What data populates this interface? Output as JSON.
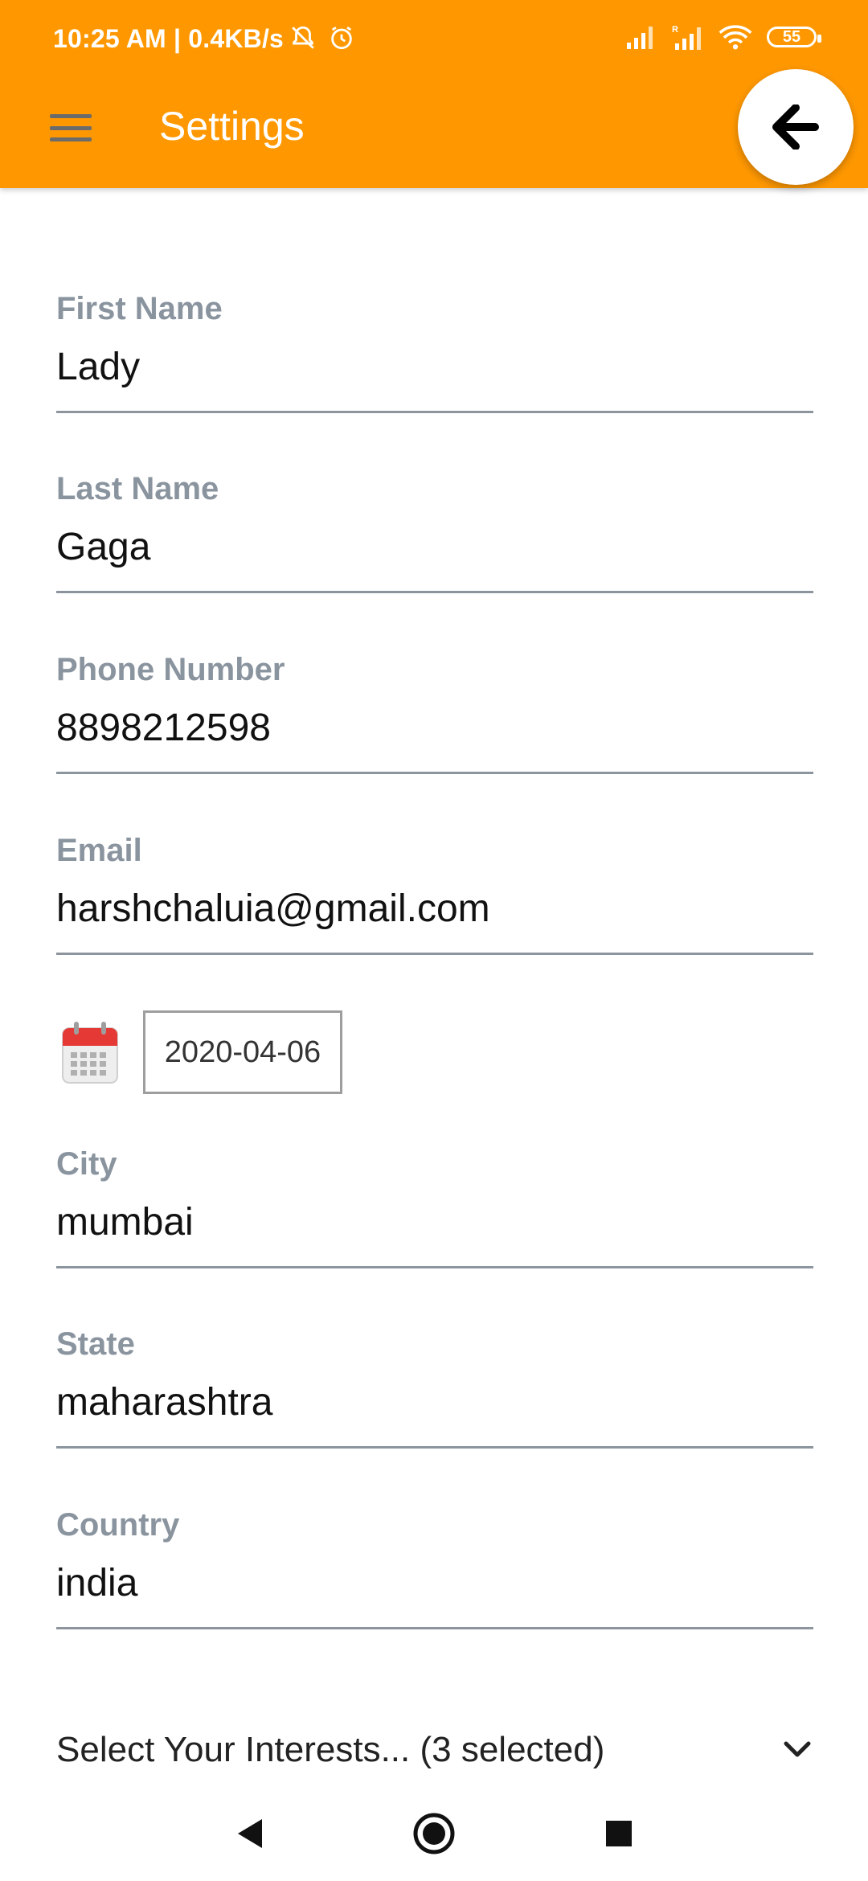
{
  "status_bar": {
    "time_info": "10:25 AM | 0.4KB/s",
    "battery": "55",
    "icons": [
      "bell-off-icon",
      "alarm-icon",
      "signal-icon",
      "signal-roaming-icon",
      "wifi-icon",
      "battery-icon"
    ]
  },
  "header": {
    "title": "Settings",
    "menu_icon": "hamburger-menu-icon",
    "back_icon": "arrow-back-icon",
    "background": "#FF9800"
  },
  "form": {
    "first_name": {
      "label": "First Name",
      "value": "Lady"
    },
    "last_name": {
      "label": "Last Name",
      "value": "Gaga"
    },
    "phone": {
      "label": "Phone Number",
      "value": "8898212598"
    },
    "email": {
      "label": "Email",
      "value": "harshchaluia@gmail.com"
    },
    "date": {
      "icon": "calendar-icon",
      "value": "2020-04-06"
    },
    "city": {
      "label": "City",
      "value": "mumbai"
    },
    "state": {
      "label": "State",
      "value": "maharashtra"
    },
    "country": {
      "label": "Country",
      "value": "india"
    }
  },
  "interests": {
    "label": "Select Your Interests... (3 selected)",
    "icon": "chevron-down-icon"
  },
  "nav": {
    "icons": [
      "nav-back-icon",
      "nav-home-icon",
      "nav-recents-icon"
    ]
  }
}
